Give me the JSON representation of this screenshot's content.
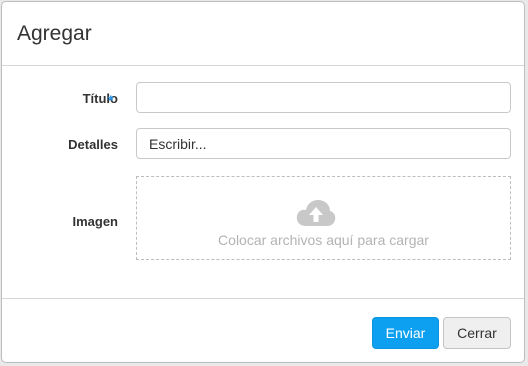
{
  "modal": {
    "title": "Agregar",
    "fields": {
      "titulo_label": "Título",
      "required_marker": "*",
      "titulo_value": "",
      "detalles_label": "Detalles",
      "detalles_placeholder": "Escribir...",
      "imagen_label": "Imagen",
      "dropzone_text": "Colocar archivos aquí para cargar",
      "dropzone_icon": "cloud-upload-icon"
    },
    "buttons": {
      "submit_label": "Enviar",
      "close_label": "Cerrar"
    }
  },
  "colors": {
    "accent": "#0ea0f0",
    "required": "#2196f3"
  }
}
